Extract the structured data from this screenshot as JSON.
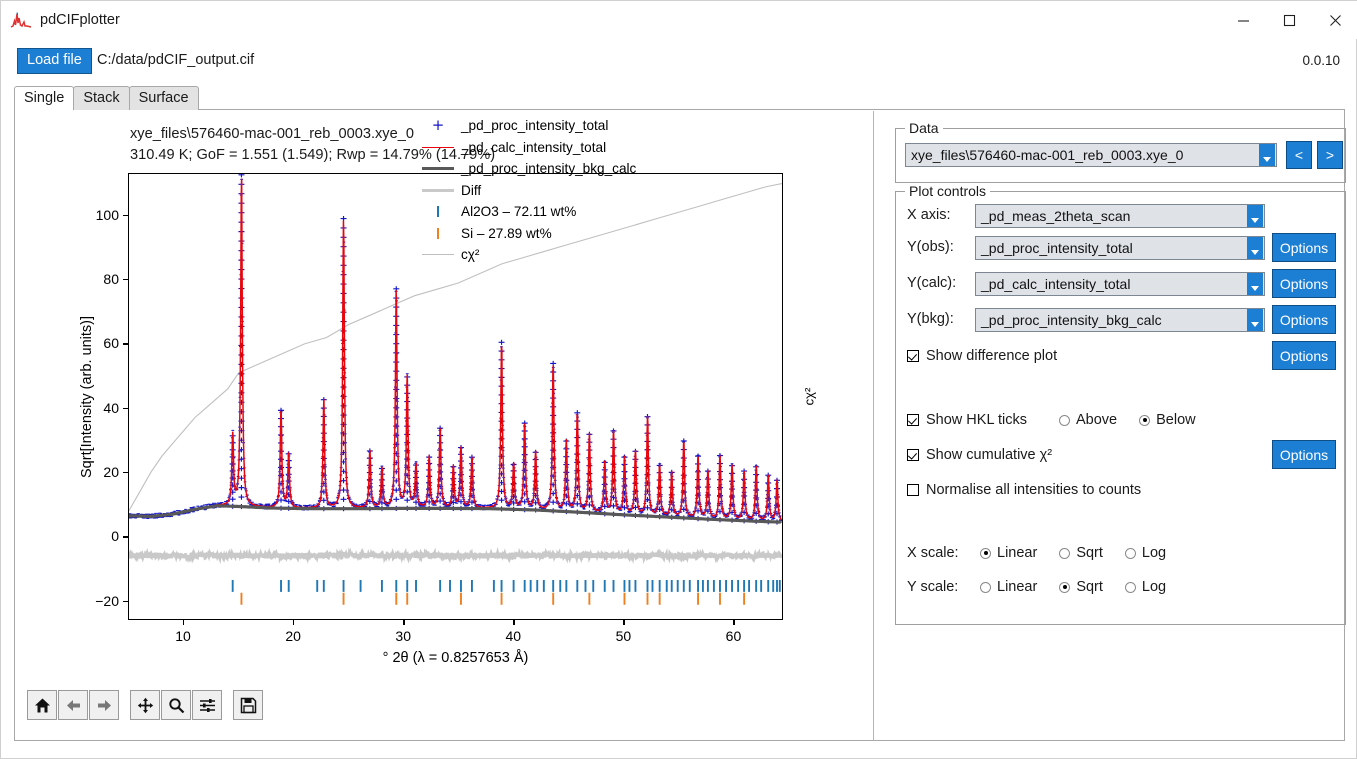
{
  "window": {
    "title": "pdCIFplotter",
    "icon": "diffraction-pattern-icon",
    "minimize": "—",
    "maximize": "□",
    "close": "✕"
  },
  "toolbar": {
    "load_file_label": "Load file",
    "file_path": "C:/data/pdCIF_output.cif",
    "version": "0.0.10"
  },
  "tabs": [
    {
      "label": "Single",
      "active": true
    },
    {
      "label": "Stack",
      "active": false
    },
    {
      "label": "Surface",
      "active": false
    }
  ],
  "plot": {
    "title_line1": "xye_files\\576460-mac-001_reb_0003.xye_0",
    "title_line2": "310.49 K; GoF = 1.551 (1.549); Rwp = 14.79% (14.79%)",
    "xlabel": "° 2θ (λ = 0.8257653 Å)",
    "ylabel": "Sqrt[Intensity (arb. units)]",
    "ylabel_right": "cχ²"
  },
  "legend": [
    {
      "label": "_pd_proc_intensity_total",
      "key": "plus",
      "color": "#1515c9"
    },
    {
      "label": "_pd_calc_intensity_total",
      "key": "line",
      "color": "#e8050d",
      "width": 1.6
    },
    {
      "label": "_pd_proc_intensity_bkg_calc",
      "key": "line",
      "color": "#585858",
      "width": 3.4
    },
    {
      "label": "Diff",
      "key": "line",
      "color": "#c9c9c9",
      "width": 3.4
    },
    {
      "label": "Al2O3 – 72.11 wt%",
      "key": "tick",
      "color": "#1f77b4"
    },
    {
      "label": "Si – 27.89 wt%",
      "key": "tick",
      "color": "#ef7f1f"
    },
    {
      "label": "cχ²",
      "key": "line",
      "color": "#c0c0c0",
      "width": 1.1
    }
  ],
  "nav_buttons": [
    {
      "name": "home-icon",
      "glyph": "⌂"
    },
    {
      "name": "back-arrow-icon",
      "glyph": "⬅"
    },
    {
      "name": "forward-arrow-icon",
      "glyph": "➡"
    },
    {
      "name": "pan-move-icon",
      "glyph": "✚"
    },
    {
      "name": "zoom-magnifier-icon",
      "glyph": "⚲"
    },
    {
      "name": "configure-subplots-icon",
      "glyph": "≡"
    },
    {
      "name": "save-floppy-icon",
      "glyph": "💾"
    }
  ],
  "data_group": {
    "title": "Data",
    "selected": "xye_files\\576460-mac-001_reb_0003.xye_0",
    "prev_label": "<",
    "next_label": ">"
  },
  "plot_controls": {
    "title": "Plot controls",
    "rows": [
      {
        "label": "X axis:",
        "value": "_pd_meas_2theta_scan",
        "options": null
      },
      {
        "label": "Y(obs):",
        "value": "_pd_proc_intensity_total",
        "options": "Options"
      },
      {
        "label": "Y(calc):",
        "value": "_pd_calc_intensity_total",
        "options": "Options"
      },
      {
        "label": "Y(bkg):",
        "value": "_pd_proc_intensity_bkg_calc",
        "options": "Options"
      }
    ],
    "show_difference_plot": {
      "label": "Show difference plot",
      "checked": true,
      "options": "Options"
    },
    "show_hkl_ticks": {
      "label": "Show HKL ticks",
      "checked": true,
      "position_options": [
        {
          "label": "Above",
          "selected": false
        },
        {
          "label": "Below",
          "selected": true
        }
      ]
    },
    "show_cumulative_chi2": {
      "label": "Show cumulative χ²",
      "checked": true,
      "options": "Options"
    },
    "normalise": {
      "label": "Normalise all intensities to counts",
      "checked": false
    },
    "x_scale": {
      "label": "X scale:",
      "options": [
        {
          "label": "Linear",
          "selected": true
        },
        {
          "label": "Sqrt",
          "selected": false
        },
        {
          "label": "Log",
          "selected": false
        }
      ]
    },
    "y_scale": {
      "label": "Y scale:",
      "options": [
        {
          "label": "Linear",
          "selected": false
        },
        {
          "label": "Sqrt",
          "selected": true
        },
        {
          "label": "Log",
          "selected": false
        }
      ]
    }
  },
  "colors": {
    "accent_blue": "#1d7fd4",
    "obs_blue": "#1515c9",
    "calc_red": "#e8050d",
    "bkg_grey": "#585858",
    "diff_grey": "#c9c9c9",
    "phase1_blue": "#1f77b4",
    "phase2_orange": "#ef7f1f",
    "cchi2_grey": "#c0c0c0"
  },
  "chart_data": {
    "type": "line",
    "title": "xye_files\\576460-mac-001_reb_0003.xye_0 — 310.49 K; GoF = 1.551 (1.549); Rwp = 14.79% (14.79%)",
    "xlabel": "° 2θ (λ = 0.8257653 Å)",
    "ylabel": "Sqrt[Intensity (arb. units)]",
    "ylabel_right": "cχ²",
    "xlim": [
      5.0,
      64.5
    ],
    "ylim": [
      -26,
      113
    ],
    "xticks": [
      10,
      20,
      30,
      40,
      50,
      60
    ],
    "yticks": [
      -20,
      0,
      20,
      40,
      60,
      80,
      100
    ],
    "grid": false,
    "legend_position": "upper right",
    "series": [
      {
        "name": "_pd_proc_intensity_total",
        "style": "plus-markers",
        "color": "#1515c9"
      },
      {
        "name": "_pd_calc_intensity_total",
        "style": "line",
        "color": "#e8050d"
      },
      {
        "name": "_pd_proc_intensity_bkg_calc",
        "style": "thick-line",
        "color": "#585858"
      },
      {
        "name": "Diff",
        "style": "thick-line",
        "color": "#c9c9c9",
        "offset_y": -6
      },
      {
        "name": "cχ²",
        "style": "line",
        "color": "#c0c0c0",
        "axis": "right"
      }
    ],
    "background_curve": [
      [
        5.0,
        6.4
      ],
      [
        7.0,
        6.2
      ],
      [
        9.0,
        6.9
      ],
      [
        11.0,
        8.4
      ],
      [
        13.0,
        9.5
      ],
      [
        15.0,
        9.3
      ],
      [
        18.0,
        8.8
      ],
      [
        22.0,
        8.6
      ],
      [
        26.0,
        8.6
      ],
      [
        30.0,
        8.7
      ],
      [
        34.0,
        8.7
      ],
      [
        38.0,
        8.6
      ],
      [
        42.0,
        8.2
      ],
      [
        46.0,
        7.5
      ],
      [
        50.0,
        6.7
      ],
      [
        54.0,
        6.0
      ],
      [
        58.0,
        5.3
      ],
      [
        62.0,
        4.7
      ],
      [
        64.5,
        4.4
      ]
    ],
    "cumulative_chi2_curve": [
      [
        5.0,
        8
      ],
      [
        6.0,
        14
      ],
      [
        7.0,
        20
      ],
      [
        8.0,
        25
      ],
      [
        9.0,
        29
      ],
      [
        10.0,
        33
      ],
      [
        11.0,
        37
      ],
      [
        12.0,
        40
      ],
      [
        13.0,
        43
      ],
      [
        14.0,
        46
      ],
      [
        15.0,
        51
      ],
      [
        17.0,
        54
      ],
      [
        19.0,
        57
      ],
      [
        21.0,
        60
      ],
      [
        23.0,
        62
      ],
      [
        25.0,
        66
      ],
      [
        27.0,
        69
      ],
      [
        29.0,
        72
      ],
      [
        31.0,
        75
      ],
      [
        33.0,
        77
      ],
      [
        35.0,
        79
      ],
      [
        37.0,
        82
      ],
      [
        39.0,
        85
      ],
      [
        41.0,
        87
      ],
      [
        43.0,
        89
      ],
      [
        45.0,
        91
      ],
      [
        47.0,
        93
      ],
      [
        49.0,
        95
      ],
      [
        51.0,
        97
      ],
      [
        53.0,
        99
      ],
      [
        55.0,
        101
      ],
      [
        57.0,
        103
      ],
      [
        59.0,
        105
      ],
      [
        61.0,
        107
      ],
      [
        63.0,
        109
      ],
      [
        64.5,
        110
      ]
    ],
    "peaks": [
      [
        14.45,
        22.0
      ],
      [
        15.25,
        103.5
      ],
      [
        18.85,
        30.5
      ],
      [
        19.55,
        17.0
      ],
      [
        22.75,
        34.0
      ],
      [
        24.55,
        90.5
      ],
      [
        26.95,
        18.0
      ],
      [
        28.05,
        12.5
      ],
      [
        29.35,
        68.5
      ],
      [
        30.35,
        41.0
      ],
      [
        31.15,
        13.5
      ],
      [
        32.35,
        16.0
      ],
      [
        33.35,
        25.0
      ],
      [
        34.55,
        13.0
      ],
      [
        35.25,
        19.0
      ],
      [
        36.25,
        16.0
      ],
      [
        38.95,
        52.0
      ],
      [
        40.05,
        14.0
      ],
      [
        41.05,
        27.0
      ],
      [
        42.05,
        18.0
      ],
      [
        43.65,
        46.0
      ],
      [
        44.85,
        22.0
      ],
      [
        45.85,
        31.0
      ],
      [
        46.95,
        24.5
      ],
      [
        48.35,
        16.0
      ],
      [
        49.15,
        26.0
      ],
      [
        50.15,
        18.0
      ],
      [
        51.15,
        20.0
      ],
      [
        52.25,
        31.0
      ],
      [
        53.35,
        16.0
      ],
      [
        54.45,
        14.0
      ],
      [
        55.55,
        24.0
      ],
      [
        56.85,
        19.5
      ],
      [
        57.75,
        15.0
      ],
      [
        58.85,
        20.0
      ],
      [
        59.95,
        17.0
      ],
      [
        61.05,
        15.5
      ],
      [
        62.15,
        17.0
      ],
      [
        63.25,
        14.5
      ],
      [
        64.05,
        13.0
      ]
    ],
    "hkl_ticks": {
      "position": "below",
      "rows": [
        {
          "phase": "Al2O3 – 72.11 wt%",
          "color": "#1f77b4",
          "y": -15.5,
          "positions": [
            14.45,
            18.85,
            19.55,
            22.15,
            22.75,
            24.55,
            26.1,
            28.05,
            29.35,
            30.35,
            31.15,
            33.35,
            34.25,
            35.25,
            36.25,
            38.25,
            38.95,
            40.05,
            41.05,
            41.6,
            42.2,
            42.8,
            43.65,
            44.3,
            44.85,
            45.85,
            46.6,
            47.3,
            48.35,
            49.15,
            50.15,
            50.6,
            51.15,
            52.25,
            52.7,
            53.35,
            54.0,
            54.45,
            55.0,
            55.55,
            56.1,
            56.85,
            57.3,
            57.75,
            58.3,
            58.85,
            59.4,
            59.95,
            60.5,
            61.05,
            61.5,
            62.15,
            62.6,
            63.25,
            63.7,
            64.05,
            64.3
          ]
        },
        {
          "phase": "Si – 27.89 wt%",
          "color": "#ef7f1f",
          "y": -19.5,
          "positions": [
            15.25,
            24.55,
            29.35,
            30.35,
            35.25,
            38.95,
            43.65,
            46.95,
            50.15,
            52.25,
            53.35,
            56.85,
            58.85,
            61.05
          ]
        }
      ]
    }
  }
}
